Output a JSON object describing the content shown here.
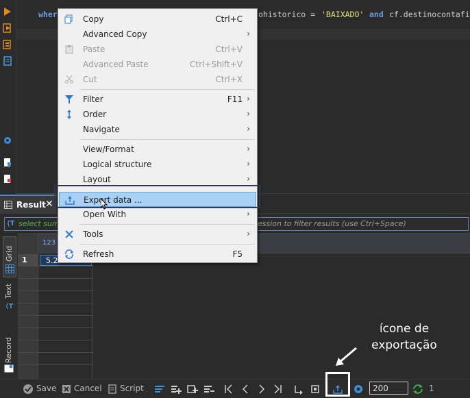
{
  "editor": {
    "line_start": "wher",
    "line_rest": "ohistorico = ",
    "string_value": "'BAIXADO'",
    "keyword_and": "and",
    "line_tail": "cf.destinocontafi"
  },
  "context_menu": {
    "items": [
      {
        "label": "Copy",
        "shortcut": "Ctrl+C",
        "icon": "copy-icon"
      },
      {
        "label": "Advanced Copy",
        "submenu": true
      },
      {
        "label": "Paste",
        "shortcut": "Ctrl+V",
        "disabled": true,
        "icon": "paste-icon"
      },
      {
        "label": "Advanced Paste",
        "shortcut": "Ctrl+Shift+V",
        "disabled": true
      },
      {
        "label": "Cut",
        "shortcut": "Ctrl+X",
        "disabled": true,
        "icon": "scissors-icon"
      },
      {
        "label": "Filter",
        "shortcut": "F11",
        "submenu": true,
        "icon": "filter-icon"
      },
      {
        "label": "Order",
        "submenu": true,
        "icon": "sort-icon"
      },
      {
        "label": "Navigate",
        "submenu": true
      },
      {
        "label": "View/Format",
        "submenu": true
      },
      {
        "label": "Logical structure",
        "submenu": true
      },
      {
        "label": "Layout",
        "submenu": true
      },
      {
        "label": "Export data ...",
        "highlighted": true,
        "icon": "export-icon"
      },
      {
        "label": "Open With",
        "submenu": true
      },
      {
        "label": "Tools",
        "submenu": true,
        "icon": "tools-icon"
      },
      {
        "label": "Refresh",
        "shortcut": "F5",
        "icon": "refresh-icon"
      }
    ],
    "submenu_arrow": "›"
  },
  "results": {
    "tab_label": "Result",
    "tab_close": "✕",
    "filter_prefix": "select sum",
    "filter_placeholder_rest": "ession to filter results (use Ctrl+Space)",
    "column_header": "123 s",
    "row_number": "1",
    "cell_value": "5.24"
  },
  "side_tabs": {
    "grid": "Grid",
    "text": "Text",
    "record": "Record"
  },
  "annotation": {
    "line1": "ícone de",
    "line2": "exportação"
  },
  "toolbar": {
    "save": "Save",
    "cancel": "Cancel",
    "script": "Script",
    "fetch_size": "200",
    "refresh_count": "1"
  },
  "colors": {
    "accent_blue": "#3d8fd6",
    "highlight": "#a9d0f5",
    "background": "#2b2b2b",
    "refresh_green": "#3cb043"
  }
}
